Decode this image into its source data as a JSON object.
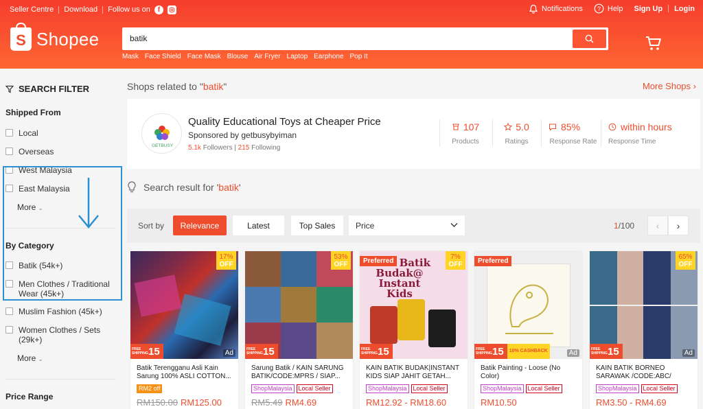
{
  "topbar": {
    "seller_centre": "Seller Centre",
    "download": "Download",
    "follow_us": "Follow us on",
    "notifications": "Notifications",
    "help": "Help",
    "sign_up": "Sign Up",
    "login": "Login"
  },
  "logo": {
    "text": "Shopee",
    "letter": "S"
  },
  "search": {
    "query": "batik"
  },
  "hot_keywords": [
    "Mask",
    "Face Shield",
    "Face Mask",
    "Blouse",
    "Air Fryer",
    "Laptop",
    "Earphone",
    "Pop It"
  ],
  "sidebar": {
    "title": "SEARCH FILTER",
    "shipped_from": {
      "label": "Shipped From",
      "options": [
        "Local",
        "Overseas",
        "West Malaysia",
        "East Malaysia"
      ],
      "more": "More"
    },
    "by_category": {
      "label": "By Category",
      "options": [
        "Batik (54k+)",
        "Men Clothes / Traditional Wear (45k+)",
        "Muslim Fashion (45k+)",
        "Women Clothes / Sets (29k+)"
      ],
      "more": "More"
    },
    "price_range": {
      "label": "Price Range"
    }
  },
  "shops_related": {
    "prefix": "Shops related to \"",
    "keyword": "batik",
    "suffix": "\"",
    "more": "More Shops"
  },
  "shop": {
    "name": "Quality Educational Toys at Cheaper Price",
    "sponsored_by": "Sponsored by getbusybyiman",
    "followers_count": "5.1k",
    "followers_label": "Followers",
    "following_count": "215",
    "following_label": "Following",
    "logo_text": "GETBUSY",
    "stats": [
      {
        "value": "107",
        "label": "Products",
        "icon": "products-icon"
      },
      {
        "value": "5.0",
        "label": "Ratings",
        "icon": "star-icon"
      },
      {
        "value": "85%",
        "label": "Response Rate",
        "icon": "chat-icon"
      },
      {
        "value": "within hours",
        "label": "Response Time",
        "icon": "clock-icon"
      }
    ]
  },
  "result": {
    "prefix": "Search result for '",
    "keyword": "batik",
    "suffix": "'"
  },
  "sort": {
    "label": "Sort by",
    "relevance": "Relevance",
    "latest": "Latest",
    "top_sales": "Top Sales",
    "price": "Price",
    "page_current": "1",
    "page_total": "/100"
  },
  "products": [
    {
      "title": "Batik Terengganu Asli Kain Sarung 100% ASLI COTTON...",
      "discount_pct": "17%",
      "off": "OFF",
      "ad": "Ad",
      "free_shipping": "15",
      "tags": [
        "RM2 off"
      ],
      "old_price": "RM150.00",
      "price": "RM125.00"
    },
    {
      "title": "Sarung Batik / KAIN SARUNG BATIK/CODE:MPRS / SIAP...",
      "discount_pct": "53%",
      "off": "OFF",
      "free_shipping": "15",
      "tags": [
        "ShopMalaysia",
        "Local Seller"
      ],
      "old_price": "RM5.49",
      "price": "RM4.69"
    },
    {
      "title": "KAIN BATIK BUDAK|INSTANT KIDS SIAP JAHIT GETAH...",
      "discount_pct": "7%",
      "off": "OFF",
      "preferred": "Preferred",
      "free_shipping": "15",
      "tags": [
        "ShopMalaysia",
        "Local Seller"
      ],
      "price": "RM12.92 - RM18.60",
      "img_text": "Kain Batik Budak@ Instant Kids"
    },
    {
      "title": "Batik Painting - Loose (No Color)",
      "preferred": "Preferred",
      "ad": "Ad",
      "free_shipping": "15",
      "cashback": "10% CASHBACK",
      "tags": [
        "ShopMalaysia",
        "Local Seller"
      ],
      "price": "RM10.50"
    },
    {
      "title": "KAIN BATIK BORNEO SARAWAK /CODE:ABC/ KAIN...",
      "discount_pct": "65%",
      "off": "OFF",
      "ad": "Ad",
      "free_shipping": "15",
      "tags": [
        "ShopMalaysia",
        "Local Seller"
      ],
      "price": "RM3.50 - RM4.69"
    }
  ],
  "colors": {
    "brand": "#ee4d2d",
    "highlight": "#2b8fd4"
  }
}
